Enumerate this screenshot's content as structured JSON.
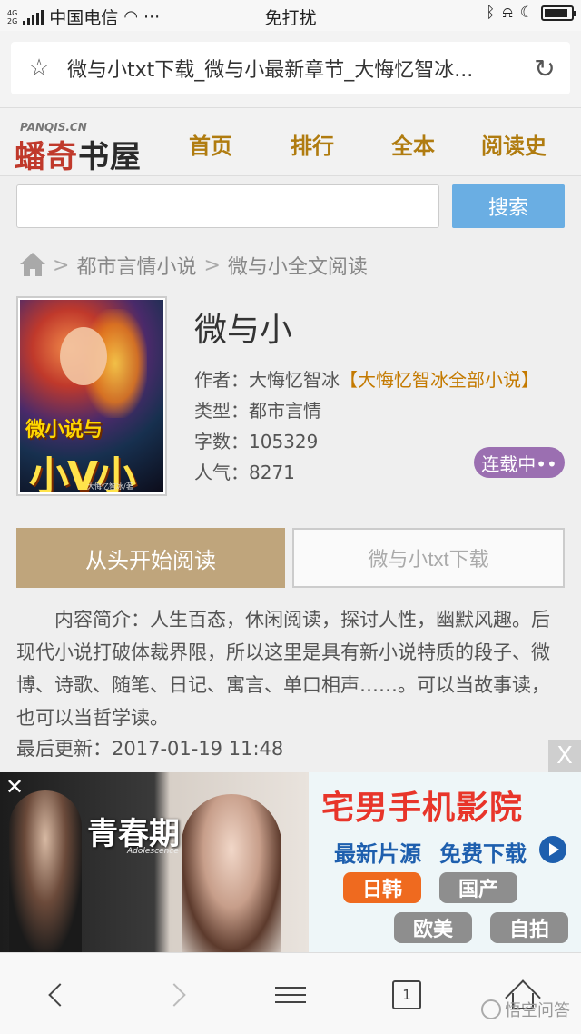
{
  "status_bar": {
    "network": "4G⁺\n2G",
    "carrier": "中国电信",
    "more": "···",
    "mode": "免打扰",
    "icons": [
      "bluetooth-icon",
      "bell-off-icon",
      "moon-icon",
      "battery-icon"
    ]
  },
  "browser": {
    "url_title": "微与小txt下载_微与小最新章节_大悔忆智冰...",
    "icons": [
      "star-icon",
      "reload-icon"
    ]
  },
  "site": {
    "logo_small": "PANQIS.CN",
    "logo_red": "蟠奇",
    "logo_black": "书屋",
    "nav": [
      "首页",
      "排行",
      "全本",
      "阅读史"
    ]
  },
  "search": {
    "placeholder": "",
    "button": "搜索"
  },
  "breadcrumb": {
    "category": "都市言情小说",
    "current": "微与小全文阅读",
    "separator": ">"
  },
  "book": {
    "cover_title": "微小说与",
    "cover_sub": "小V小说",
    "cover_author": "大悔忆智冰/著",
    "title": "微与小",
    "author_label": "作者：",
    "author": "大悔忆智冰",
    "author_link": "【大悔忆智冰全部小说】",
    "type_label": "类型：",
    "type": "都市言情",
    "words_label": "字数：",
    "words": "105329",
    "popularity_label": "人气：",
    "popularity": "8271",
    "status": "连载中••"
  },
  "actions": {
    "read_button": "从头开始阅读",
    "download_button": "微与小txt下载"
  },
  "description": {
    "text": "内容简介：人生百态，休闲阅读，探讨人性，幽默风趣。后现代小说打破体裁界限，所以这里是具有新小说特质的段子、微博、诗歌、随笔、日记、寓言、单口相声……。可以当故事读，也可以当哲学读。",
    "updated_label": "最后更新：",
    "updated": "2017-01-19 11:48"
  },
  "ad": {
    "close": "X",
    "close_small": "✕",
    "left_title": "青春期",
    "left_sub": "Adolescence",
    "headline": "宅男手机影院",
    "line2a": "最新片源",
    "line2b": "免费下载",
    "tags": [
      {
        "label": "日韩",
        "color": "#ef6a1f"
      },
      {
        "label": "国产",
        "color": "#8e8e8e"
      },
      {
        "label": "欧美",
        "color": "#8e8e8e"
      },
      {
        "label": "自拍",
        "color": "#8e8e8e"
      }
    ]
  },
  "bottom_nav": {
    "tab_count": "1",
    "icons": [
      "back-icon",
      "forward-icon",
      "menu-icon",
      "tabs-icon",
      "home-icon"
    ]
  },
  "watermark": "悟空问答"
}
